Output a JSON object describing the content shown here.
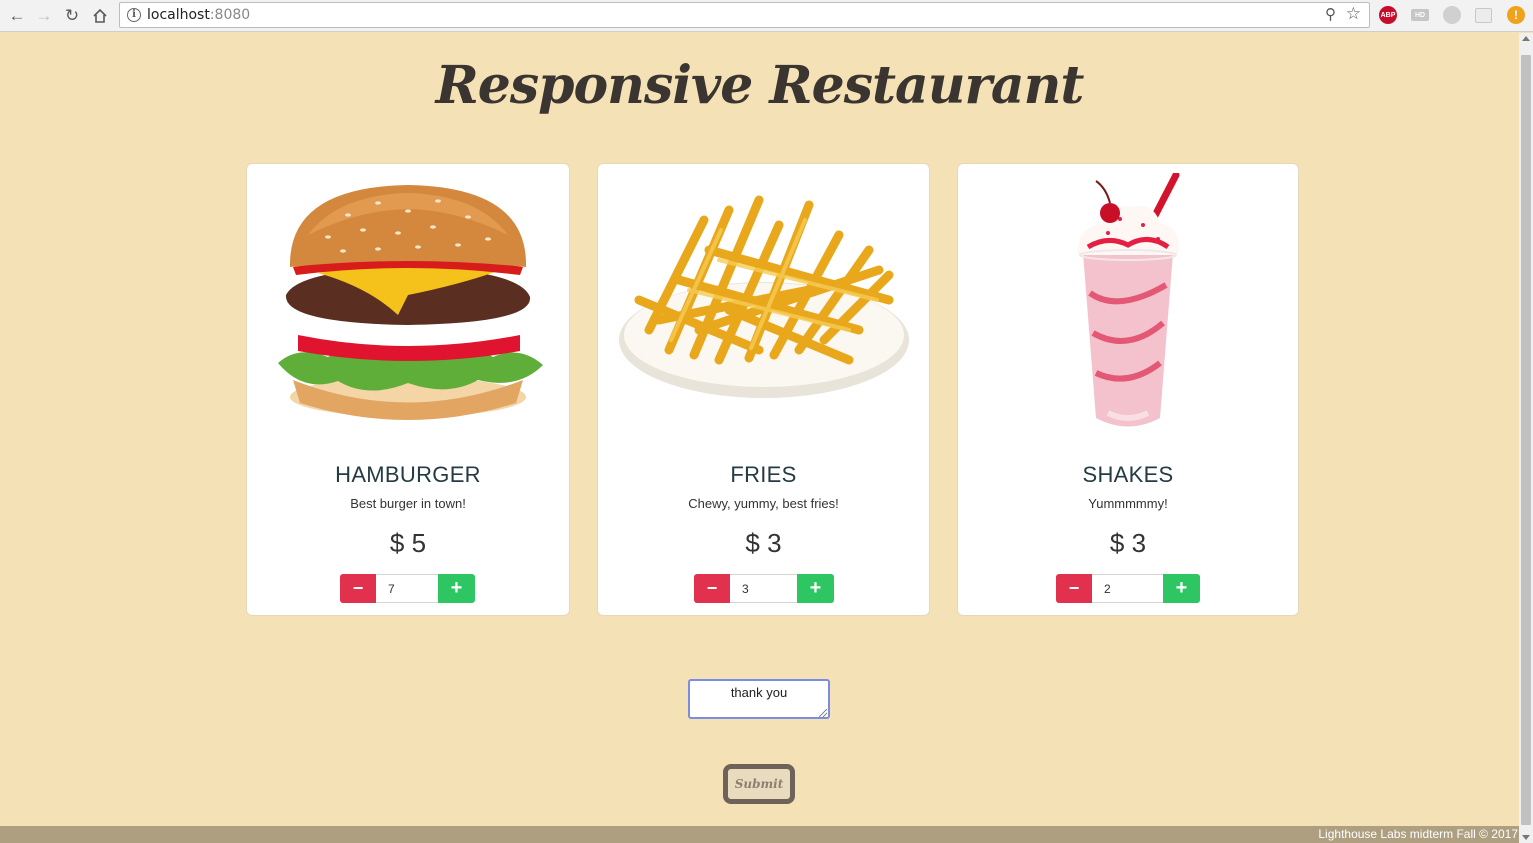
{
  "browser": {
    "url_host": "localhost",
    "url_port": ":8080",
    "extensions": [
      "ABP",
      "HD",
      "",
      "",
      "!"
    ]
  },
  "page": {
    "title": "Responsive Restaurant"
  },
  "menu": [
    {
      "name": "HAMBURGER",
      "description": "Best burger in town!",
      "price": "$ 5",
      "quantity": "7",
      "image": "hamburger-image"
    },
    {
      "name": "FRIES",
      "description": "Chewy, yummy, best fries!",
      "price": "$ 3",
      "quantity": "3",
      "image": "fries-image"
    },
    {
      "name": "SHAKES",
      "description": "Yummmmmy!",
      "price": "$ 3",
      "quantity": "2",
      "image": "milkshake-image"
    }
  ],
  "stepper": {
    "minus_label": "−",
    "plus_label": "+"
  },
  "order": {
    "note": "thank you",
    "submit_label": "Submit"
  },
  "footer": {
    "text": "Lighthouse Labs midterm Fall © 2017"
  },
  "colors": {
    "background": "#f5e1b6",
    "minus": "#e2304f",
    "plus": "#2ec662",
    "footer": "#ae9f80"
  }
}
